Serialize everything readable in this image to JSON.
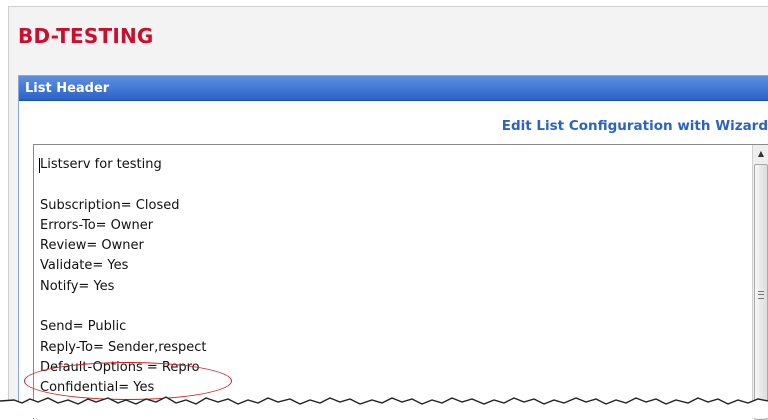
{
  "page": {
    "title": "BD-TESTING"
  },
  "panel": {
    "header_title": "List Header",
    "wizard_link": "Edit List Configuration with Wizard"
  },
  "list_header_text": {
    "lines": [
      "Listserv for testing",
      "",
      "Subscription= Closed",
      "Errors-To= Owner",
      "Review= Owner",
      "Validate= Yes",
      "Notify= Yes",
      "",
      "Send= Public",
      "Reply-To= Sender,respect",
      "Default-Options = Repro",
      "Confidential= Yes"
    ]
  },
  "colors": {
    "title": "#c8102e",
    "header_bar": "#2b62c7",
    "link": "#2a63c6",
    "annotation": "#cc1f1f"
  },
  "icons": {
    "scroll_up": "arrow-up-icon",
    "scroll_grip": "grip-icon"
  }
}
